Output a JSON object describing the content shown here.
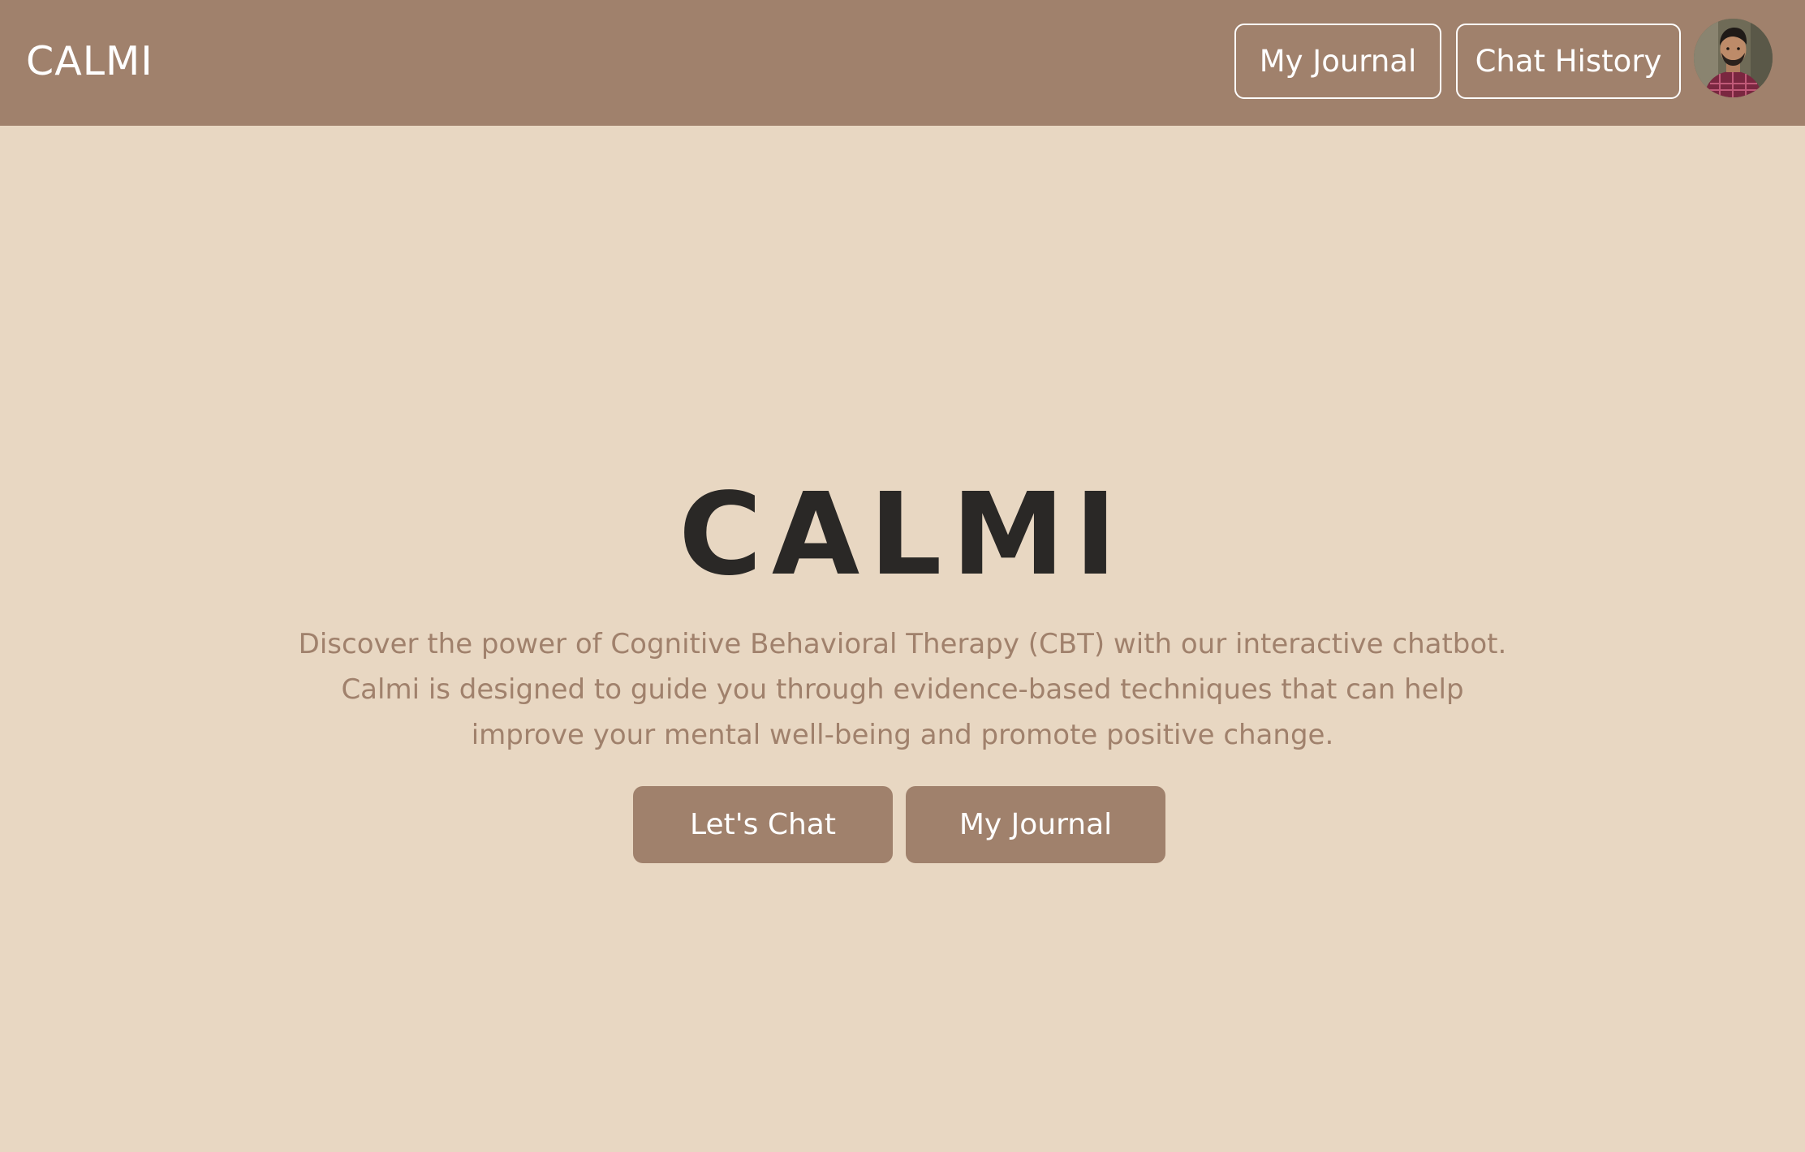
{
  "header": {
    "brand": "CALMI",
    "nav": {
      "journal_label": "My Journal",
      "history_label": "Chat History"
    },
    "avatar_icon": "user-avatar-icon"
  },
  "hero": {
    "title": "CALMI",
    "description_lines": [
      "Discover the power of Cognitive Behavioral Therapy (CBT) with our interactive chatbot.",
      "Calmi is designed to guide you through evidence-based techniques that can help",
      "improve your mental well-being and promote positive change."
    ],
    "buttons": {
      "chat_label": "Let's Chat",
      "journal_label": "My Journal"
    }
  },
  "colors": {
    "header_bg": "#a0816c",
    "page_bg": "#e8d7c2",
    "title_text": "#2a2826",
    "body_text": "#a0816c",
    "button_bg": "#a0816c",
    "button_text": "#ffffff"
  }
}
